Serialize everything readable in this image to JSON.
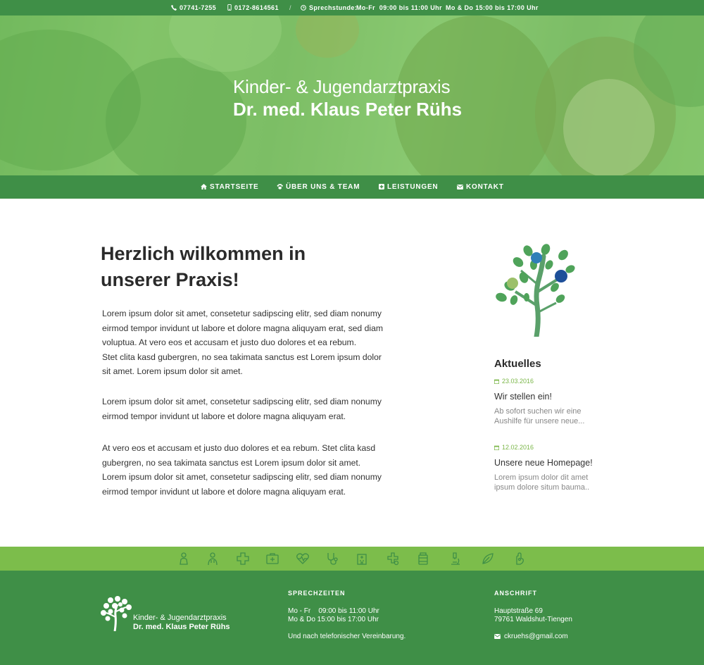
{
  "topbar": {
    "phone1": "07741-7255",
    "phone2": "0172-8614561",
    "separator": "/",
    "hours_label": "Sprechstunde:",
    "hours1": "Mo-Fr  09:00 bis 11:00 Uhr",
    "hours2": "Mo & Do 15:00 bis 17:00 Uhr"
  },
  "hero": {
    "title_line1": "Kinder- & Jugendarztpraxis",
    "title_line2": "Dr. med. Klaus Peter Rühs"
  },
  "nav": {
    "items": [
      {
        "label": "STARTSEITE",
        "icon": "home-icon"
      },
      {
        "label": "ÜBER UNS & TEAM",
        "icon": "paw-icon"
      },
      {
        "label": "LEISTUNGEN",
        "icon": "plus-square-icon"
      },
      {
        "label": "KONTAKT",
        "icon": "envelope-icon"
      }
    ]
  },
  "main": {
    "heading_line1": "Herzlich wilkommen in",
    "heading_line2": "unserer Praxis!",
    "paragraphs": [
      [
        "Lorem ipsum dolor sit amet, consetetur sadipscing elitr, sed diam nonumy",
        "eirmod tempor invidunt ut labore et dolore magna aliquyam erat, sed diam",
        "voluptua. At vero eos et accusam et justo duo dolores et ea rebum.",
        "Stet clita kasd gubergren, no sea takimata sanctus est Lorem ipsum dolor",
        "sit amet. Lorem ipsum dolor sit amet."
      ],
      [
        "Lorem ipsum dolor sit amet, consetetur sadipscing elitr, sed diam nonumy",
        "eirmod tempor invidunt ut labore et dolore magna aliquyam erat."
      ],
      [
        "At vero eos et accusam et justo duo dolores et ea rebum. Stet clita kasd",
        "gubergren, no sea takimata sanctus est Lorem ipsum dolor sit amet.",
        "Lorem ipsum dolor sit amet, consetetur sadipscing elitr, sed diam nonumy",
        "eirmod tempor invidunt ut labore et dolore magna aliquyam erat."
      ]
    ]
  },
  "sidebar": {
    "title": "Aktuelles",
    "news": [
      {
        "date": "23.03.2016",
        "title": "Wir stellen ein!",
        "text_line1": "Ab sofort suchen wir eine",
        "text_line2": "Aushilfe für unsere neue..."
      },
      {
        "date": "12.02.2016",
        "title": "Unsere neue Homepage!",
        "text_line1": "Lorem ipsum dolor dit amet",
        "text_line2": "ipsum dolore situm bauma.."
      }
    ]
  },
  "iconband": {
    "icons": [
      "child-icon",
      "doctor-icon",
      "bandage-icon",
      "first-aid-kit-icon",
      "heartbeat-icon",
      "stethoscope-icon",
      "hospital-icon",
      "pill-cross-icon",
      "medicine-bottle-icon",
      "microscope-icon",
      "leaf-icon",
      "hand-icon"
    ]
  },
  "footer": {
    "brand_line1": "Kinder- & Jugendarztpraxis",
    "brand_line2": "Dr. med. Klaus Peter Rühs",
    "hours_heading": "SPRECHZEITEN",
    "hours_line1": "Mo - Fr    09:00 bis 11:00 Uhr",
    "hours_line2": "Mo & Do 15:00 bis 17:00 Uhr",
    "hours_note": "Und nach telefonischer Vereinbarung.",
    "address_heading": "ANSCHRIFT",
    "street": "Hauptstraße 69",
    "city": "79761 Waldshut-Tiengen",
    "email": "ckruehs@gmail.com"
  },
  "colors": {
    "primary_green": "#3f8f47",
    "light_green": "#7cbd4b",
    "accent_date": "#7ab648"
  }
}
